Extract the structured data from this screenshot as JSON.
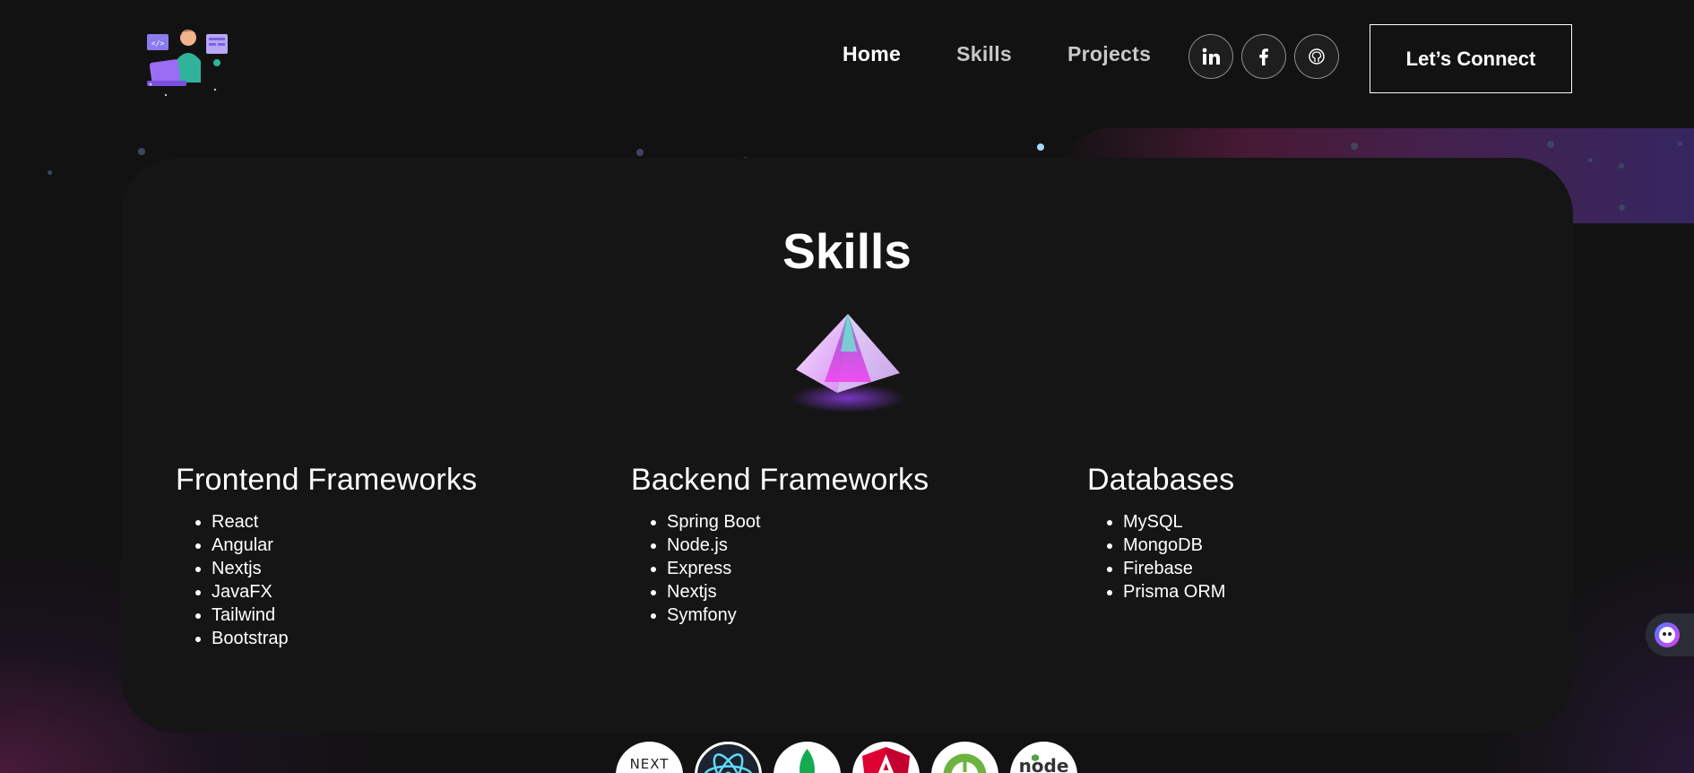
{
  "header": {
    "nav": {
      "home": "Home",
      "skills": "Skills",
      "projects": "Projects"
    },
    "social_icons": [
      "linkedin-icon",
      "facebook-icon",
      "github-icon"
    ],
    "connect_label": "Let’s Connect"
  },
  "skills": {
    "title": "Skills",
    "columns": [
      {
        "heading": "Frontend Frameworks",
        "items": [
          "React",
          "Angular",
          "Nextjs",
          "JavaFX",
          "Tailwind",
          "Bootstrap"
        ]
      },
      {
        "heading": "Backend Frameworks",
        "items": [
          "Spring Boot",
          "Node.js",
          "Express",
          "Nextjs",
          "Symfony"
        ]
      },
      {
        "heading": "Databases",
        "items": [
          "MySQL",
          "MongoDB",
          "Firebase",
          "Prisma ORM"
        ]
      }
    ]
  },
  "tech_logos": [
    "nextjs-logo",
    "react-logo",
    "mongodb-logo",
    "angular-logo",
    "spring-logo",
    "nodejs-logo"
  ],
  "colors": {
    "background": "#121212",
    "card": "#151515",
    "accent_pink": "#e040fb",
    "accent_purple": "#5b3aa0"
  }
}
